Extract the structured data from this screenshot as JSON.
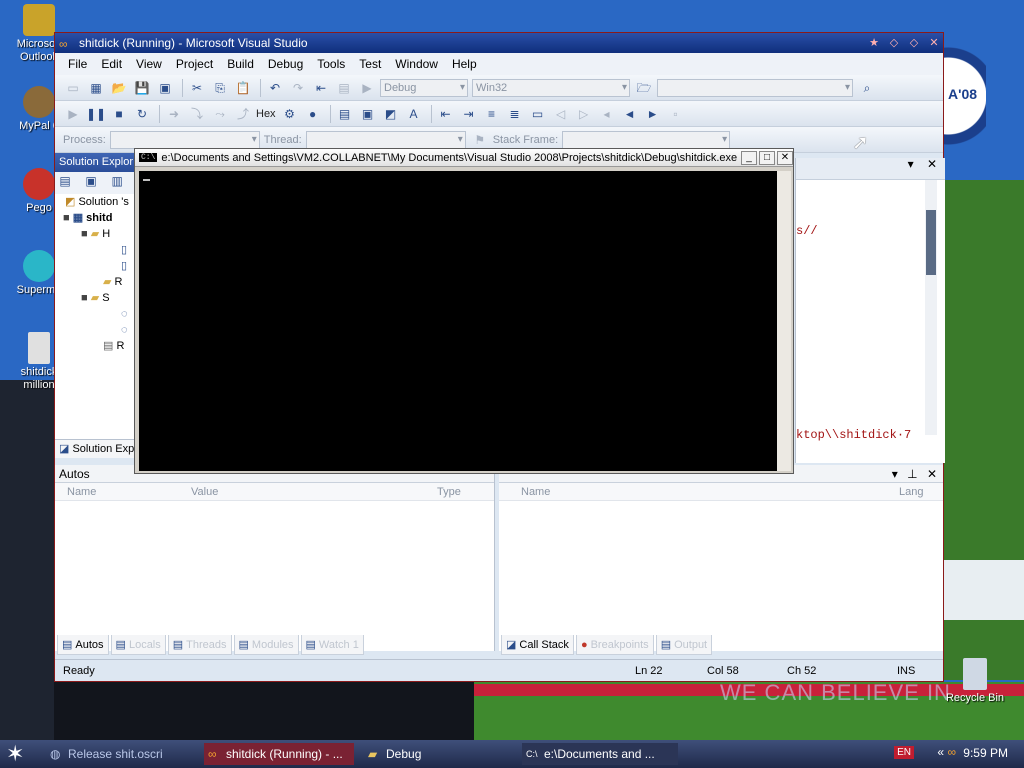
{
  "desktop": {
    "icons": [
      {
        "label": "Microsoft Outlook",
        "color": "#c9a32a"
      },
      {
        "label": "MyPal 6",
        "color": "#8a6a3a"
      },
      {
        "label": "Pego",
        "color": "#c8322a"
      },
      {
        "label": "Supermu",
        "color": "#2ab6c8"
      },
      {
        "label": "shitdick million",
        "color": "#e0e0e0"
      }
    ],
    "recycle_bin": "Recycle Bin",
    "slogan": "WE CAN BELIEVE IN",
    "campaign_badge": "A'08"
  },
  "vs": {
    "title": "shitdick (Running) - Microsoft Visual Studio",
    "menu": [
      "File",
      "Edit",
      "View",
      "Project",
      "Build",
      "Debug",
      "Tools",
      "Test",
      "Window",
      "Help"
    ],
    "toolbar1": {
      "config_combo": "Debug",
      "platform_combo": "Win32"
    },
    "toolbar2": {
      "hex_label": "Hex"
    },
    "toolbar3": {
      "process_label": "Process:",
      "thread_label": "Thread:",
      "stack_frame_label": "Stack Frame:"
    },
    "solution_explorer": {
      "header": "Solution Explor",
      "rows": [
        "Solution 's",
        "shitd",
        "H",
        "",
        "",
        "R",
        "S",
        "",
        "",
        "R"
      ],
      "tab": "Solution Exp"
    },
    "editor": {
      "line1": "s//",
      "line2": "ktop\\\\shitdick·7"
    },
    "autos": {
      "header": "Autos",
      "columns": [
        "Name",
        "Value",
        "Type"
      ],
      "tabs": [
        "Autos",
        "Locals",
        "Threads",
        "Modules",
        "Watch 1"
      ]
    },
    "callstack": {
      "columns": [
        "Name",
        "Lang"
      ],
      "tabs": [
        "Call Stack",
        "Breakpoints",
        "Output"
      ]
    },
    "status": {
      "ready": "Ready",
      "ln": "Ln 22",
      "col": "Col 58",
      "ch": "Ch 52",
      "ins": "INS"
    }
  },
  "console": {
    "title": "e:\\Documents and Settings\\VM2.COLLABNET\\My Documents\\Visual Studio 2008\\Projects\\shitdick\\Debug\\shitdick.exe",
    "icon_text": "C:\\"
  },
  "taskbar": {
    "tasks": [
      {
        "label": "Release shit.oscri",
        "icon": "web-icon"
      },
      {
        "label": "shitdick (Running) - ...",
        "icon": "vs-icon"
      },
      {
        "label": "Debug",
        "icon": "folder-icon"
      },
      {
        "label": "e:\\Documents and ...",
        "icon": "console-icon"
      }
    ],
    "language": "EN",
    "clock": "9:59 PM"
  }
}
